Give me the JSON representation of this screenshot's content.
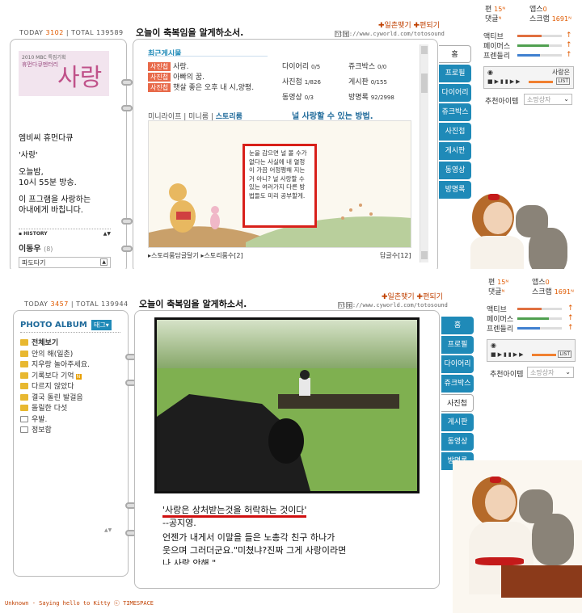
{
  "shot1": {
    "today_label": "TODAY",
    "today": "3102",
    "total_label": "TOTAL",
    "total": "139589",
    "mood": "오늘이 축복임을 알게하소서.",
    "link_ilchon": "일촌맺기",
    "link_pyeon": "편되기",
    "url": "http://www.cyworld.com/totosound",
    "banner_small1": "2010 MBC 특집기획",
    "banner_small2": "휴먼다큐멘터리",
    "banner_big": "사랑",
    "profile_lines": [
      "엠비씨 휴먼다큐",
      "'사랑'",
      "오늘밤,",
      "10시 55분 방송.",
      "이 프그램을 사랑하는",
      "아내에게 바칩니다."
    ],
    "history_label": "HISTORY",
    "name": "이동우",
    "name_count": "(8)",
    "select_value": "파도타기",
    "recent_title": "최근게시물",
    "posts": [
      {
        "tag": "사진첩",
        "text": "사랑."
      },
      {
        "tag": "사진첩",
        "text": "아빠의 꿈."
      },
      {
        "tag": "사진첩",
        "text": "햇살 좋은 오후 내 시,양평."
      }
    ],
    "counters": [
      {
        "label": "다이어리",
        "value": "0/5"
      },
      {
        "label": "쥬크박스",
        "value": "0/0"
      },
      {
        "label": "사진첩",
        "value": "1/826"
      },
      {
        "label": "게시판",
        "value": "0/155"
      },
      {
        "label": "동영상",
        "value": "0/3"
      },
      {
        "label": "방명록",
        "value": "92/2998"
      }
    ],
    "mini_tabs": [
      "미니라이프",
      "미니룸",
      "스토리룸"
    ],
    "story_title": "널 사랑할 수 있는 방법.",
    "story_text": "눈을 감으면 널 볼 수가 없다는 사실에 내 열정이 가끔 어정쩡해 지는 거 아니? 널 사랑할 수 있는 여러가지 다른 방법들도 미리 공부할게.",
    "story_link1": "스토리룸담글달기",
    "story_link2": "스토리룸수[2]",
    "reply": "답글수[12]",
    "nav": [
      "홈",
      "프로필",
      "다이어리",
      "쥬크박스",
      "사진첩",
      "게시판",
      "동영상",
      "방명록"
    ],
    "stats": {
      "pyeon_label": "편",
      "pyeon": "15",
      "apps_label": "앱스",
      "apps": "0",
      "comment_label": "댓글",
      "scrap_label": "스크랩",
      "scrap": "1691"
    },
    "bars": [
      {
        "label": "액티브",
        "fill": 0.55,
        "color": "#e07040"
      },
      {
        "label": "페이머스",
        "fill": 0.7,
        "color": "#50a050"
      },
      {
        "label": "프렌들리",
        "fill": 0.5,
        "color": "#4080d0"
      }
    ],
    "player_title": "사랑은",
    "list_label": "LIST",
    "recommend": "추천아이템",
    "select2": "소망상자"
  },
  "shot2": {
    "today_label": "TODAY",
    "today": "3457",
    "total_label": "TOTAL",
    "total": "139944",
    "mood": "오늘이 축복임을 알게하소서.",
    "link_ilchon": "일촌맺기",
    "link_pyeon": "편되기",
    "url": "http://www.cyworld.com/totosound",
    "album_title": "PHOTO ALBUM",
    "tag_button": "태그",
    "folders": [
      {
        "name": "전체보기",
        "bold": true,
        "doc": false,
        "new": false
      },
      {
        "name": "안의 해(일촌)",
        "bold": false,
        "doc": false,
        "new": false
      },
      {
        "name": "지우랑 놀아주세요.",
        "bold": false,
        "doc": false,
        "new": false
      },
      {
        "name": "기록보다 기억",
        "bold": false,
        "doc": false,
        "new": true
      },
      {
        "name": "다르지 않았다",
        "bold": false,
        "doc": false,
        "new": false
      },
      {
        "name": "결국 돌린 발걸음",
        "bold": false,
        "doc": false,
        "new": false
      },
      {
        "name": "돌릴한 다섯",
        "bold": false,
        "doc": false,
        "new": false
      },
      {
        "name": "우발.",
        "bold": false,
        "doc": true,
        "new": false
      },
      {
        "name": "정보함",
        "bold": false,
        "doc": true,
        "new": false
      }
    ],
    "quote": "'사랑은 상처받는것을 허락하는 것이다'",
    "author": "--공지영.",
    "body1": "언젠가 내게서 이말을 들은 노총각 친구 하나가",
    "body2": "웃으며 그러더군요.\"미쳤냐?진짜 그게 사랑이라면",
    "body3": "나 사랑 안해.\"",
    "footer": "Unknown - Saying hello to Kitty ⓒ TIMESPACE",
    "nav": [
      "홈",
      "프로필",
      "다이어리",
      "쥬크박스",
      "사진첩",
      "게시판",
      "동영상",
      "방명록"
    ],
    "stats": {
      "pyeon_label": "편",
      "pyeon": "15",
      "apps_label": "앱스",
      "apps": "0",
      "comment_label": "댓글",
      "scrap_label": "스크랩",
      "scrap": "1691"
    },
    "bars": [
      {
        "label": "액티브",
        "fill": 0.55,
        "color": "#e07040"
      },
      {
        "label": "페이머스",
        "fill": 0.7,
        "color": "#50a050"
      },
      {
        "label": "프렌들리",
        "fill": 0.5,
        "color": "#4080d0"
      }
    ],
    "list_label": "LIST",
    "recommend": "추천아이템",
    "select2": "소망상자"
  }
}
